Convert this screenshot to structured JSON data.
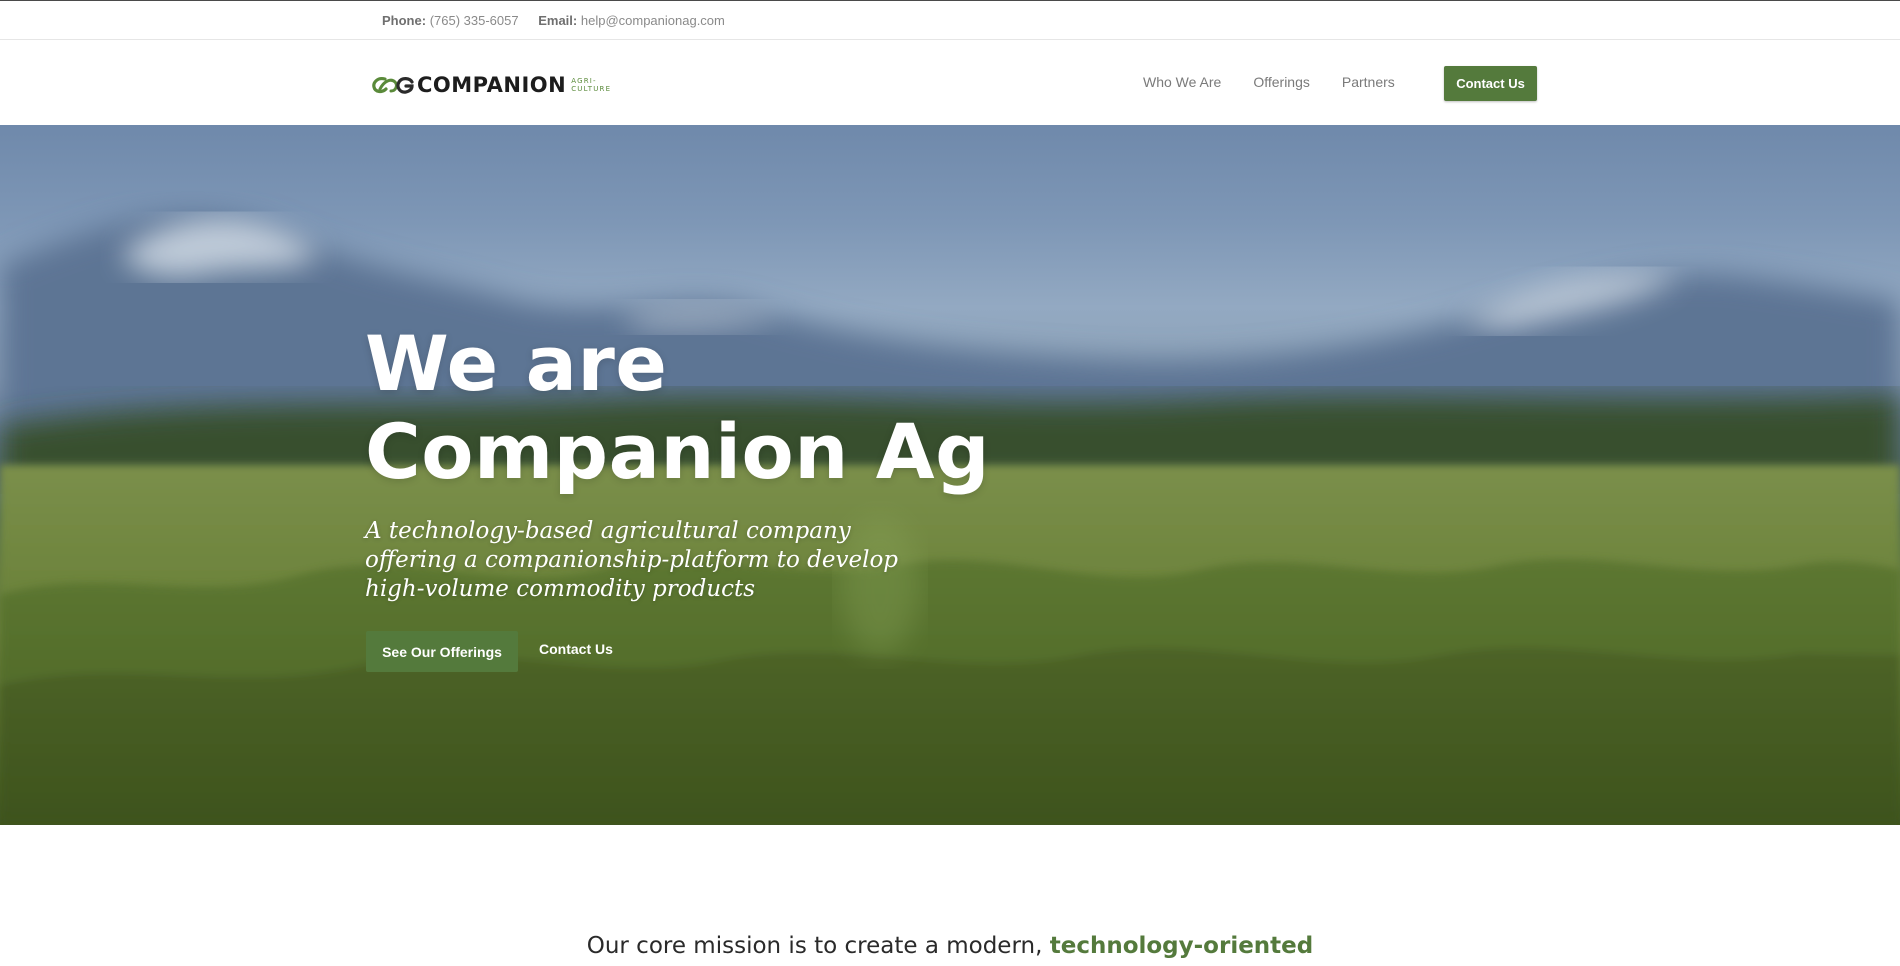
{
  "topbar": {
    "phone_label": "Phone:",
    "phone_value": "(765) 335-6057",
    "email_label": "Email:",
    "email_value": "help@companionag.com"
  },
  "header": {
    "logo": {
      "wordmark": "COMPANION",
      "sub_line1": "AGRI-",
      "sub_line2": "CULTURE"
    },
    "nav": [
      {
        "label": "Who We Are"
      },
      {
        "label": "Offerings"
      },
      {
        "label": "Partners"
      }
    ],
    "cta_label": "Contact Us"
  },
  "hero": {
    "title_line1": "We are",
    "title_line2": "Companion Ag",
    "subtitle": "A technology-based agricultural company offering a companionship-platform to develop high-volume commodity products",
    "primary_button": "See Our Offerings",
    "secondary_button": "Contact Us"
  },
  "mission": {
    "text_prefix": "Our core mission is to create a modern, ",
    "text_highlight": "technology-oriented"
  },
  "colors": {
    "brand_green": "#547a3c",
    "text_dark": "#2a2a2a",
    "nav_gray": "#7a7a7a"
  }
}
